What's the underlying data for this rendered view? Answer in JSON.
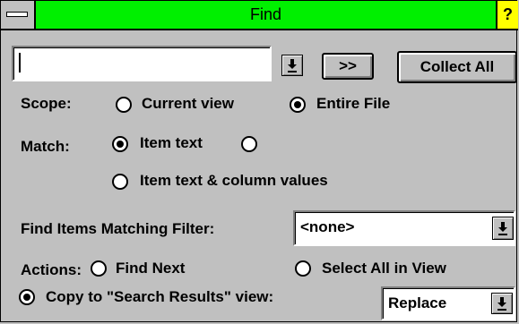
{
  "window": {
    "title": "Find",
    "help_label": "?"
  },
  "search": {
    "value": "",
    "dropdown_icon": "down-arrow-underline-icon",
    "next_label": ">>",
    "collect_all_label": "Collect All"
  },
  "scope": {
    "label": "Scope:",
    "options": [
      {
        "label": "Current view",
        "checked": false
      },
      {
        "label": "Entire File",
        "checked": true
      }
    ]
  },
  "match": {
    "label": "Match:",
    "options": [
      {
        "label": "Item text",
        "checked": true
      },
      {
        "label": "",
        "checked": false
      },
      {
        "label": "Item text & column values",
        "checked": false
      }
    ]
  },
  "filter": {
    "label": "Find Items Matching Filter:",
    "value": "<none>"
  },
  "actions": {
    "label": "Actions:",
    "options": [
      {
        "label": "Find Next",
        "checked": false
      },
      {
        "label": "Select All in View",
        "checked": false
      },
      {
        "label": "Copy to \"Search Results\" view:",
        "checked": true
      }
    ],
    "copy_mode": "Replace"
  }
}
